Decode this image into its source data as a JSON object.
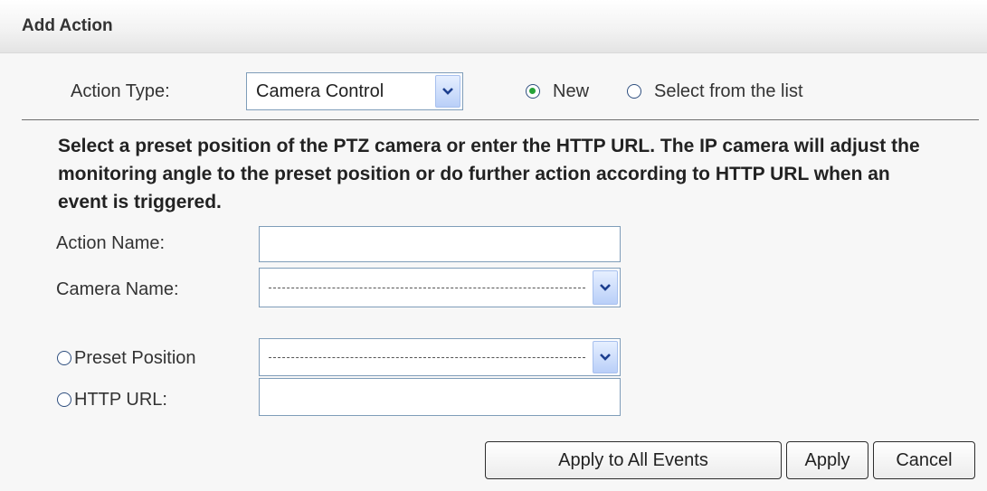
{
  "header": {
    "title": "Add Action"
  },
  "action_type": {
    "label": "Action Type:",
    "selected": "Camera Control",
    "mode_new": "New",
    "mode_list": "Select from the list",
    "mode_selected": "New"
  },
  "description": "Select a preset position of the PTZ camera or enter the HTTP URL. The IP camera will adjust the monitoring angle to the preset position or do further action according to HTTP URL when an event is triggered.",
  "form": {
    "action_name_label": "Action Name:",
    "action_name_value": "",
    "camera_name_label": "Camera Name:",
    "preset_position_label": "Preset Position",
    "http_url_label": "HTTP URL:",
    "http_url_value": ""
  },
  "buttons": {
    "apply_all": "Apply to All Events",
    "apply": "Apply",
    "cancel": "Cancel"
  },
  "icons": {
    "dropdown": "chevron-down-icon"
  },
  "colors": {
    "radio_selected": "#27a339",
    "input_border": "#7f9db9"
  }
}
